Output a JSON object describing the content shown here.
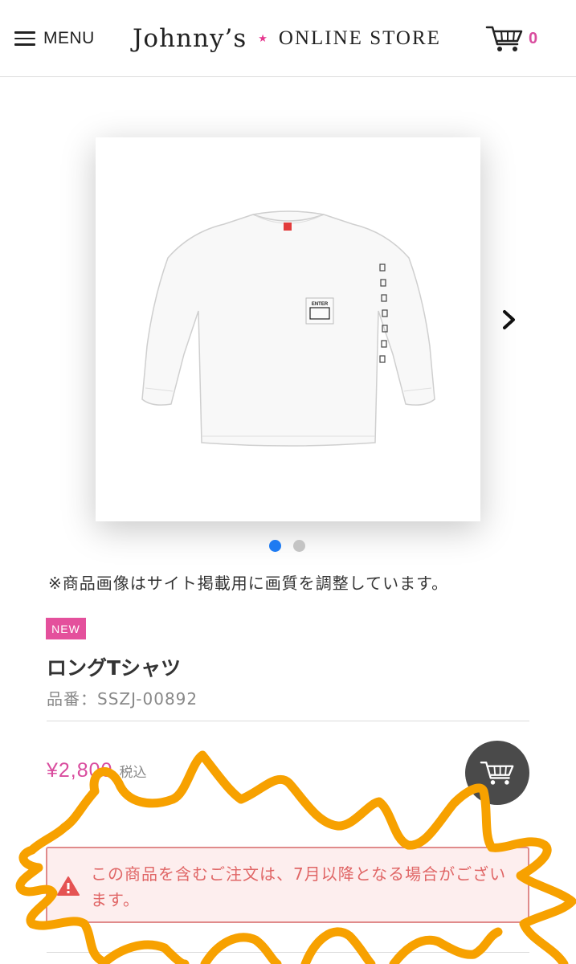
{
  "header": {
    "menu_label": "MENU",
    "logo_script": "Johnny’s",
    "logo_star": "★",
    "logo_store": "ONLINE STORE",
    "cart_count": "0"
  },
  "carousel": {
    "slide_count": 2,
    "active_index": 0,
    "shirt_print": "ENTER"
  },
  "note": "※商品画像はサイト掲載用に画質を調整しています。",
  "product": {
    "badge": "NEW",
    "name": "ロングTシャツ",
    "code": "品番：SSZJ-00892",
    "price": "¥2,800",
    "tax_label": "税込"
  },
  "alert": {
    "icon": "warning-icon",
    "text": "この商品を含むご注文は、7月以降となる場合がございます。"
  },
  "colors": {
    "brand_pink": "#d94c9e",
    "badge_pink": "#e4509c",
    "dot_active": "#1e7bf2",
    "alert_text": "#e06666",
    "alert_border": "#e08b8b",
    "alert_bg": "#fdeeee",
    "scribble_orange": "#f7a100"
  }
}
